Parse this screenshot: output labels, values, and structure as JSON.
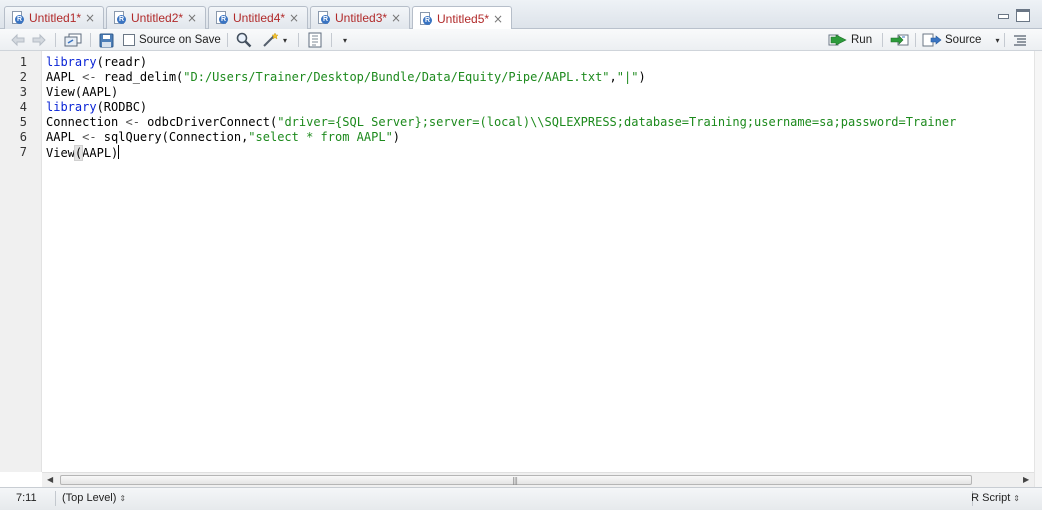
{
  "tabs": [
    {
      "label": "Untitled1*",
      "active": false
    },
    {
      "label": "Untitled2*",
      "active": false
    },
    {
      "label": "Untitled4*",
      "active": false
    },
    {
      "label": "Untitled3*",
      "active": false
    },
    {
      "label": "Untitled5*",
      "active": true
    }
  ],
  "tab_close_glyph": "×",
  "toolbar": {
    "source_on_save_label": "Source on Save",
    "source_on_save_checked": false,
    "run_label": "Run",
    "source_label": "Source"
  },
  "editor": {
    "line_numbers": [
      "1",
      "2",
      "3",
      "4",
      "5",
      "6",
      "7"
    ],
    "lines": [
      [
        {
          "t": "kw",
          "v": "library"
        },
        {
          "t": "plain",
          "v": "(readr)"
        }
      ],
      [
        {
          "t": "plain",
          "v": "AAPL "
        },
        {
          "t": "op",
          "v": "<-"
        },
        {
          "t": "plain",
          "v": " read_delim("
        },
        {
          "t": "str",
          "v": "\"D:/Users/Trainer/Desktop/Bundle/Data/Equity/Pipe/AAPL.txt\""
        },
        {
          "t": "plain",
          "v": ","
        },
        {
          "t": "str",
          "v": "\"|\""
        },
        {
          "t": "plain",
          "v": ")"
        }
      ],
      [
        {
          "t": "plain",
          "v": "View(AAPL)"
        }
      ],
      [
        {
          "t": "kw",
          "v": "library"
        },
        {
          "t": "plain",
          "v": "(RODBC)"
        }
      ],
      [
        {
          "t": "plain",
          "v": "Connection "
        },
        {
          "t": "op",
          "v": "<-"
        },
        {
          "t": "plain",
          "v": " odbcDriverConnect("
        },
        {
          "t": "str",
          "v": "\"driver={SQL Server};server=(local)\\\\SQLEXPRESS;database=Training;username=sa;password=Trainer"
        }
      ],
      [
        {
          "t": "plain",
          "v": "AAPL "
        },
        {
          "t": "op",
          "v": "<-"
        },
        {
          "t": "plain",
          "v": " sqlQuery(Connection,"
        },
        {
          "t": "str",
          "v": "\"select * from AAPL\""
        },
        {
          "t": "plain",
          "v": ")"
        }
      ],
      [
        {
          "t": "plain",
          "v": "View"
        },
        {
          "t": "paren",
          "v": "("
        },
        {
          "t": "plain",
          "v": "AAPL)"
        },
        {
          "t": "cursor",
          "v": ""
        }
      ]
    ]
  },
  "status": {
    "cursor_position": "7:11",
    "scope": "(Top Level)",
    "file_type": "R Script"
  },
  "colors": {
    "keyword": "#0a24d6",
    "string": "#1d8a1d",
    "tab_label": "#b12a2a"
  }
}
